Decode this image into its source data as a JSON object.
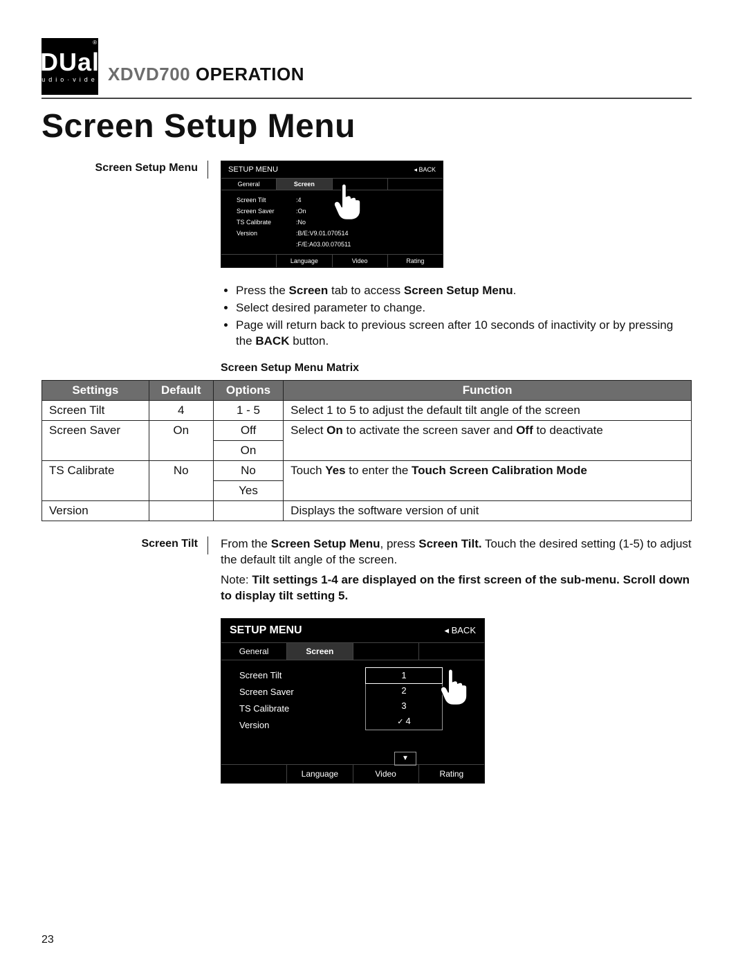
{
  "logo": {
    "brand": "DUal",
    "registered": "®",
    "tagline": "audio·video"
  },
  "header": {
    "model": "XDVD700",
    "word": "OPERATION"
  },
  "section_title": "Screen Setup Menu",
  "left_labels": {
    "l1": "Screen Setup Menu",
    "l2": "Screen Tilt"
  },
  "osd1": {
    "title": "SETUP MENU",
    "back": "◂ BACK",
    "tabs_top": [
      "General",
      "Screen",
      "",
      ""
    ],
    "tabs_top_sel": 1,
    "rows": [
      {
        "k": "Screen Tilt",
        "v": ":4"
      },
      {
        "k": "Screen Saver",
        "v": ":On"
      },
      {
        "k": "TS Calibrate",
        "v": ":No"
      },
      {
        "k": "Version",
        "v": ":B/E:V9.01.070514"
      },
      {
        "k": "",
        "v": ":F/E:A03.00.070511"
      }
    ],
    "tabs_bot": [
      "",
      "Language",
      "Video",
      "Rating"
    ]
  },
  "bullets": [
    {
      "pre": "Press the ",
      "b1": "Screen",
      "mid": " tab to access ",
      "b2": "Screen Setup Menu",
      "post": "."
    },
    {
      "plain": "Select desired parameter to change."
    },
    {
      "pre": "Page will return back to previous screen after 10 seconds of inactivity or by pressing the ",
      "b1": "BACK",
      "post": " button."
    }
  ],
  "matrix_heading": "Screen Setup Menu Matrix",
  "matrix": {
    "head": [
      "Settings",
      "Default",
      "Options",
      "Function"
    ],
    "rows": [
      {
        "s": "Screen Tilt",
        "d": "4",
        "o": "1 - 5",
        "f": "Select 1 to 5 to adjust the default tilt angle of the screen",
        "span": 1
      },
      {
        "s": "Screen Saver",
        "d": "On",
        "o": [
          "Off",
          "On"
        ],
        "f_parts": [
          "Select ",
          "On",
          " to activate the screen saver and ",
          "Off",
          " to deactivate"
        ],
        "span": 2
      },
      {
        "s": "TS Calibrate",
        "d": "No",
        "o": [
          "No",
          "Yes"
        ],
        "f_parts": [
          "Touch ",
          "Yes",
          " to enter the ",
          "Touch Screen Calibration Mode"
        ],
        "span": 2
      },
      {
        "s": "Version",
        "d": "",
        "o": "",
        "f": "Displays the software version of unit",
        "span": 1
      }
    ]
  },
  "tilt_para": {
    "p1_parts": [
      "From the ",
      "Screen Setup Menu",
      ", press ",
      "Screen Tilt.",
      " Touch the desired setting (1-5) to adjust the default tilt angle of the screen."
    ],
    "p2_parts": [
      "Note:",
      " Tilt settings 1-4 are displayed on the first screen of the sub-menu. Scroll down to display tilt setting 5."
    ]
  },
  "osd2": {
    "title": "SETUP MENU",
    "back": "◂ BACK",
    "tabs_top": [
      "General",
      "Screen",
      "",
      ""
    ],
    "tabs_top_sel": 1,
    "list": [
      "Screen Tilt",
      "Screen Saver",
      "TS Calibrate",
      "Version"
    ],
    "options": [
      "1",
      "2",
      "3",
      "4"
    ],
    "selected_opt": 0,
    "checked_opt": 3,
    "drop": "▼",
    "tabs_bot": [
      "",
      "Language",
      "Video",
      "Rating"
    ]
  },
  "page_number": "23"
}
